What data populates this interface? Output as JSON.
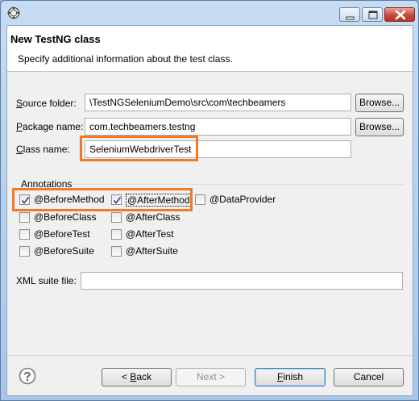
{
  "dialog": {
    "banner_title": "New TestNG class",
    "banner_description": "Specify additional information about the test class."
  },
  "form": {
    "source_folder": {
      "label": "Source folder:",
      "mnemonic": "S",
      "label_rest": "ource folder:",
      "value": "\\TestNGSeleniumDemo\\src\\com\\techbeamers",
      "browse": "Browse..."
    },
    "package_name": {
      "label": "Package name:",
      "mnemonic": "P",
      "label_rest": "ackage name:",
      "value": "com.techbeamers.testng",
      "browse": "Browse..."
    },
    "class_name": {
      "label": "Class name:",
      "mnemonic": "C",
      "label_rest": "lass name:",
      "value": "SeleniumWebdriverTest"
    }
  },
  "annotations": {
    "group_label": "Annotations",
    "items": [
      {
        "label": "@BeforeMethod",
        "checked": true
      },
      {
        "label": "@AfterMethod",
        "checked": true
      },
      {
        "label": "@DataProvider",
        "checked": false
      },
      {
        "label": "@BeforeClass",
        "checked": false
      },
      {
        "label": "@AfterClass",
        "checked": false
      },
      {
        "label": "@BeforeTest",
        "checked": false
      },
      {
        "label": "@AfterTest",
        "checked": false
      },
      {
        "label": "@BeforeSuite",
        "checked": false
      },
      {
        "label": "@AfterSuite",
        "checked": false
      }
    ]
  },
  "xml_suite": {
    "label": "XML suite file:",
    "value": ""
  },
  "buttons": {
    "back": {
      "prefix": "< ",
      "mnemonic": "B",
      "rest": "ack"
    },
    "next": {
      "label": "Next >",
      "enabled": false
    },
    "finish": {
      "mnemonic": "F",
      "rest": "inish"
    },
    "cancel": {
      "label": "Cancel"
    }
  },
  "colors": {
    "highlight": "#f07a2a",
    "titlebar": "#b9d1ea",
    "close_button": "#c8483a"
  }
}
